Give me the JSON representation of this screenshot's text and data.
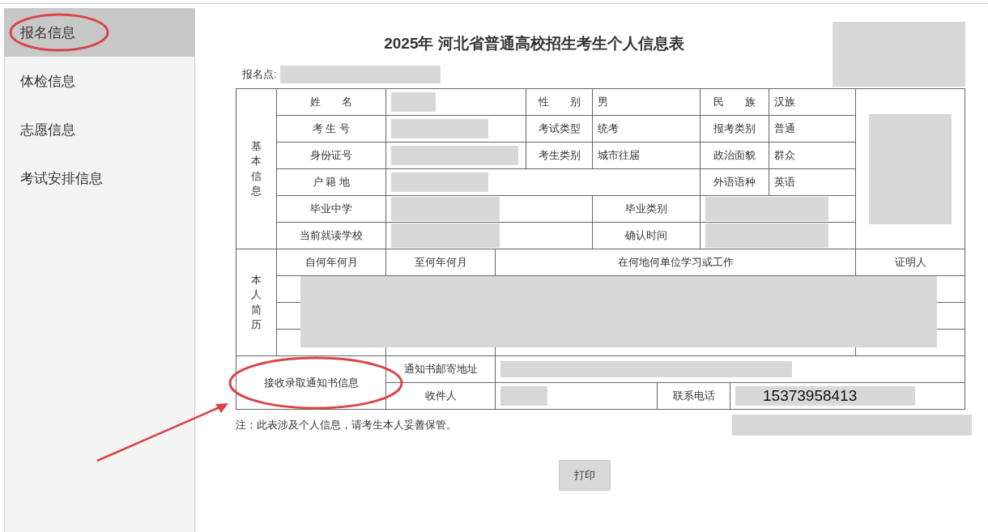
{
  "sidebar": {
    "items": [
      {
        "label": "报名信息",
        "selected": true,
        "highlighted": true
      },
      {
        "label": "体检信息",
        "selected": false,
        "highlighted": false
      },
      {
        "label": "志愿信息",
        "selected": false,
        "highlighted": false
      },
      {
        "label": "考试安排信息",
        "selected": false,
        "highlighted": false
      }
    ]
  },
  "form": {
    "title": "2025年 河北省普通高校招生考生个人信息表",
    "header_redacted": true,
    "site": {
      "label": "报名点:",
      "redacted": true
    },
    "basic_info": {
      "section": "基本信息",
      "photo_redacted": true,
      "fields": [
        {
          "label": "姓　　名",
          "redacted": true
        },
        {
          "label": "性　　别",
          "value": "男"
        },
        {
          "label": "民　　族",
          "value": "汉族"
        },
        {
          "label": "考 生 号",
          "redacted": true
        },
        {
          "label": "考试类型",
          "value": "统考"
        },
        {
          "label": "报考类别",
          "value": "普通"
        },
        {
          "label": "身份证号",
          "redacted": true
        },
        {
          "label": "考生类别",
          "value": "城市往届"
        },
        {
          "label": "政治面貌",
          "value": "群众"
        },
        {
          "label": "户 籍 地",
          "redacted": true
        },
        {
          "label": "外语语种",
          "value": "英语"
        },
        {
          "label": "毕业中学",
          "redacted": true
        },
        {
          "label": "毕业类别",
          "redacted": true
        },
        {
          "label": "当前就读学校",
          "redacted": true
        },
        {
          "label": "确认时间",
          "redacted": true
        }
      ]
    },
    "resume": {
      "section": "本人简历",
      "columns": [
        "自何年何月",
        "至何年何月",
        "在何地何单位学习或工作",
        "证明人"
      ],
      "redacted": true
    },
    "notice": {
      "section": "接收录取通知书信息",
      "highlighted": true,
      "fields": [
        {
          "label": "通知书邮寄地址",
          "redacted": true
        },
        {
          "label": "收件人",
          "redacted": true
        },
        {
          "label": "联系电话",
          "value": "15373958413",
          "redacted": true
        }
      ]
    },
    "note": {
      "text": "注：此表涉及个人信息，请考生本人妥善保管。",
      "trailing_redacted": true
    },
    "print_button": "打印"
  }
}
